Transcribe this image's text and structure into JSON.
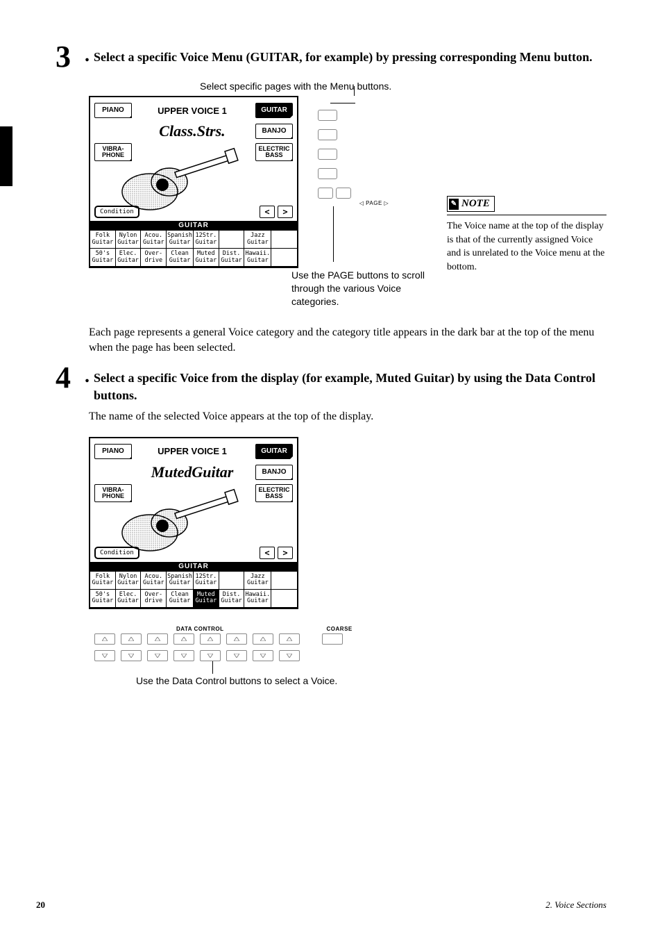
{
  "sidebar": {},
  "step3": {
    "num": "3",
    "dot": ".",
    "text": "Select a specific Voice Menu (GUITAR, for example) by pressing corresponding Menu button."
  },
  "caption_top": "Select specific pages with the Menu buttons.",
  "lcd1": {
    "piano": "PIANO",
    "title": "UPPER VOICE 1",
    "guitar": "GUITAR",
    "voice": "Class.Strs.",
    "banjo": "BANJO",
    "vibraphone": "VIBRA-\nPHONE",
    "elecbass": "ELECTRIC\nBASS",
    "condition": "Condition",
    "prev": "<",
    "next": ">",
    "category": "GUITAR",
    "grid": [
      "Folk\nGuitar",
      "Nylon\nGuitar",
      "Acou.\nGuitar",
      "Spanish\nGuitar",
      "12Str.\nGuitar",
      "",
      "Jazz\nGuitar",
      "",
      "50's\nGuitar",
      "Elec.\nGuitar",
      "Over-\ndrive",
      "Clean\nGuitar",
      "Muted\nGuitar",
      "Dist.\nGuitar",
      "Hawaii.\nGuitar",
      ""
    ],
    "selected": -1
  },
  "hw": {
    "page_label": "◁ PAGE ▷",
    "caption": "Use the PAGE buttons to scroll through the various Voice categories."
  },
  "note": {
    "label": "NOTE",
    "body": "The Voice name at the top of the display is that of the currently assigned Voice and is unrelated to the Voice menu at the bottom."
  },
  "para_mid": "Each page represents a general Voice category and the category title appears in the dark bar at the top of the menu when the page has been selected.",
  "step4": {
    "num": "4",
    "dot": ".",
    "text": "Select a specific Voice from the display (for example, Muted Guitar) by using the Data Control buttons.",
    "body": "The name of the selected Voice appears at the top of the display."
  },
  "lcd2": {
    "piano": "PIANO",
    "title": "UPPER VOICE 1",
    "guitar": "GUITAR",
    "voice": "MutedGuitar",
    "banjo": "BANJO",
    "vibraphone": "VIBRA-\nPHONE",
    "elecbass": "ELECTRIC\nBASS",
    "condition": "Condition",
    "prev": "<",
    "next": ">",
    "category": "GUITAR",
    "grid": [
      "Folk\nGuitar",
      "Nylon\nGuitar",
      "Acou.\nGuitar",
      "Spanish\nGuitar",
      "12Str.\nGuitar",
      "",
      "Jazz\nGuitar",
      "",
      "50's\nGuitar",
      "Elec.\nGuitar",
      "Over-\ndrive",
      "Clean\nGuitar",
      "Muted\nGuitar",
      "Dist.\nGuitar",
      "Hawaii.\nGuitar",
      ""
    ],
    "selected": 12
  },
  "dc": {
    "label": "DATA CONTROL",
    "coarse": "COARSE",
    "caption": "Use the Data Control buttons to select a Voice."
  },
  "footer": {
    "page": "20",
    "chapter": "2. Voice Sections"
  }
}
